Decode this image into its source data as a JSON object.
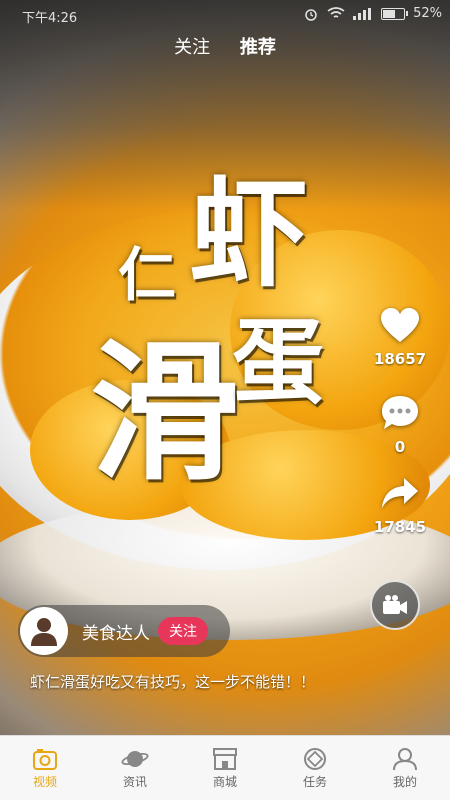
{
  "status_bar": {
    "time": "下午4:26",
    "battery": "52%"
  },
  "top_tabs": [
    {
      "label": "关注"
    },
    {
      "label": "推荐"
    }
  ],
  "video": {
    "title_chars": {
      "c1": "虾",
      "c2": "仁",
      "c3": "滑",
      "c4": "蛋"
    },
    "caption": "虾仁滑蛋好吃又有技巧，这一步不能错！！"
  },
  "actions": {
    "likes": "18657",
    "comments": "0",
    "shares": "17845"
  },
  "author": {
    "name": "美食达人",
    "follow_label": "关注"
  },
  "bottom_nav": [
    {
      "label": "视频",
      "icon": "video-icon"
    },
    {
      "label": "资讯",
      "icon": "planet-icon"
    },
    {
      "label": "商城",
      "icon": "shop-icon"
    },
    {
      "label": "任务",
      "icon": "task-icon"
    },
    {
      "label": "我的",
      "icon": "user-icon"
    }
  ],
  "colors": {
    "accent": "#e8a614",
    "follow": "#e8365b"
  }
}
